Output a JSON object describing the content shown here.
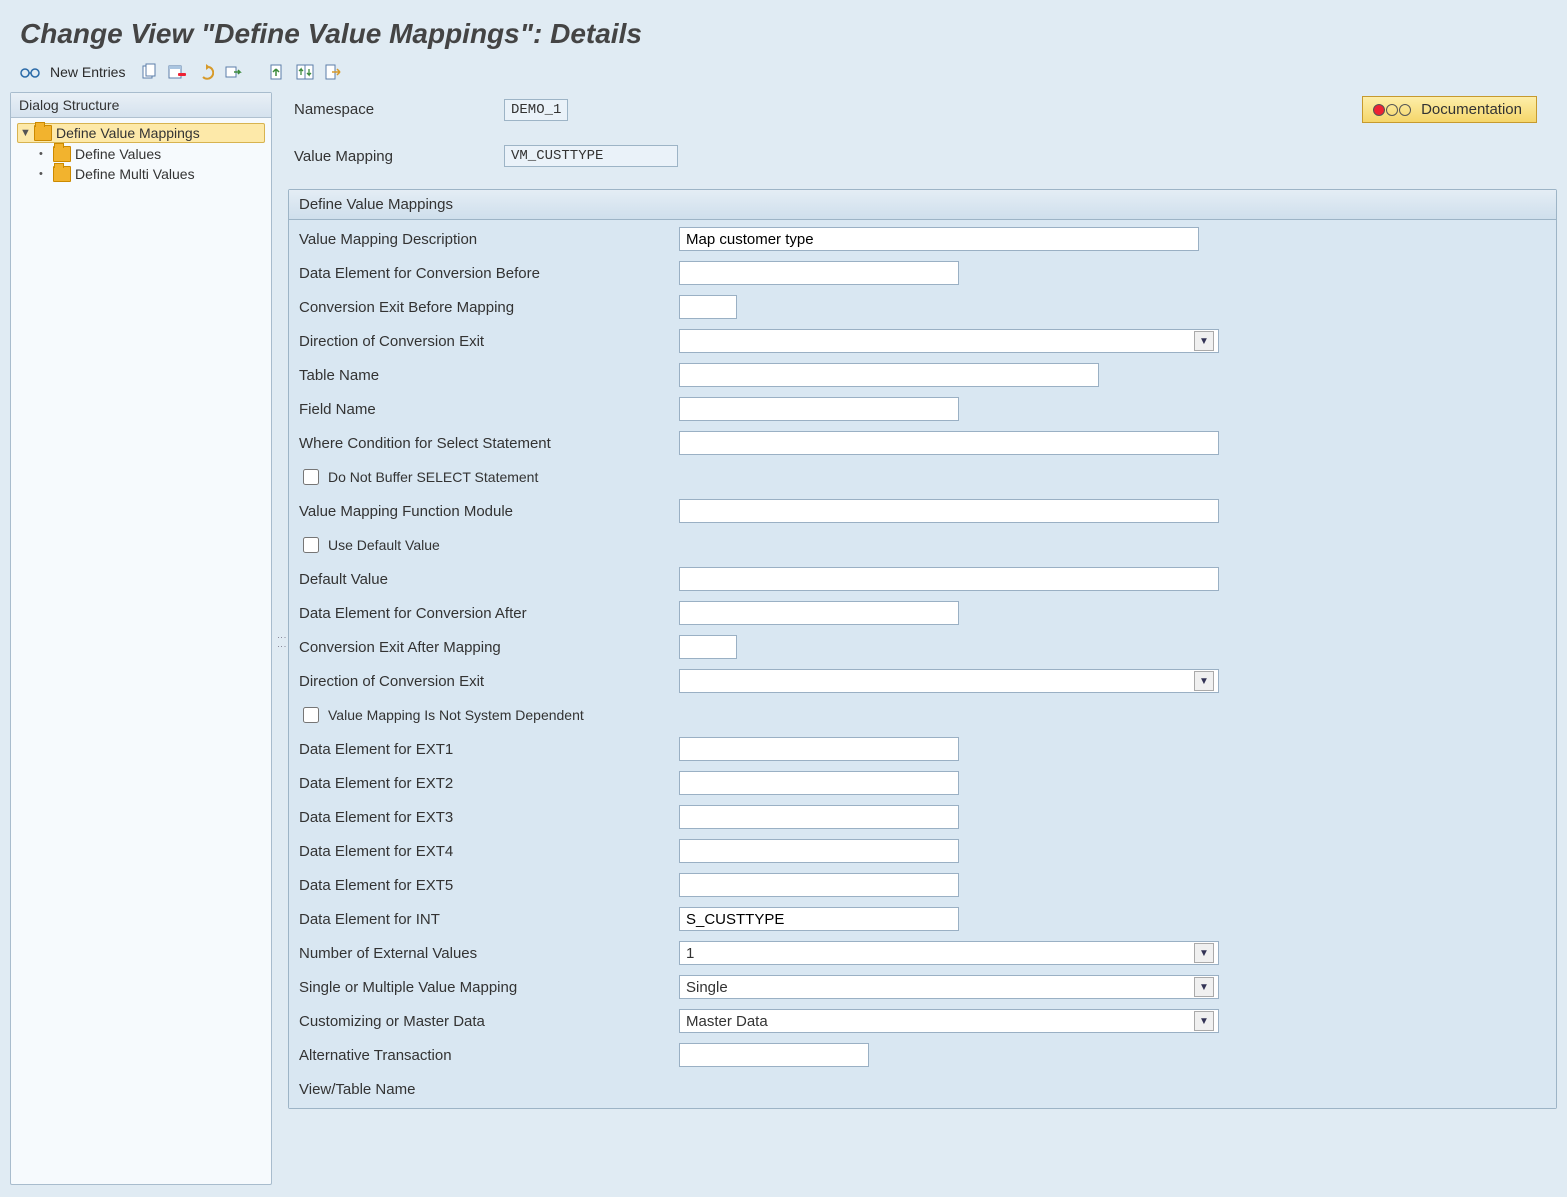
{
  "title": "Change View \"Define Value Mappings\": Details",
  "toolbar": {
    "new_entries": "New Entries"
  },
  "sidebar": {
    "header": "Dialog Structure",
    "items": [
      {
        "label": "Define Value Mappings",
        "indent": 1,
        "open": true,
        "selected": true
      },
      {
        "label": "Define Values",
        "indent": 2,
        "open": false,
        "selected": false
      },
      {
        "label": "Define Multi Values",
        "indent": 2,
        "open": false,
        "selected": false
      }
    ]
  },
  "header_fields": {
    "namespace_label": "Namespace",
    "namespace_value": "DEMO_1",
    "value_mapping_label": "Value Mapping",
    "value_mapping_value": "VM_CUSTTYPE",
    "documentation_button": "Documentation"
  },
  "panel": {
    "title": "Define Value Mappings",
    "fields": {
      "desc_label": "Value Mapping Description",
      "desc_value": "Map customer type",
      "de_before_label": "Data Element for Conversion Before",
      "de_before_value": "",
      "ce_before_label": "Conversion Exit Before Mapping",
      "ce_before_value": "",
      "dir_before_label": "Direction of Conversion Exit",
      "dir_before_value": "",
      "table_label": "Table Name",
      "table_value": "",
      "field_label": "Field Name",
      "field_value": "",
      "where_label": "Where Condition for Select Statement",
      "where_value": "",
      "no_buffer_label": "Do Not Buffer SELECT Statement",
      "func_mod_label": "Value Mapping Function Module",
      "func_mod_value": "",
      "use_default_label": "Use Default Value",
      "default_label": "Default Value",
      "default_value": "",
      "de_after_label": "Data Element for Conversion After",
      "de_after_value": "",
      "ce_after_label": "Conversion Exit After Mapping",
      "ce_after_value": "",
      "dir_after_label": "Direction of Conversion Exit",
      "dir_after_value": "",
      "not_sysdep_label": "Value Mapping Is Not System Dependent",
      "ext1_label": "Data Element for EXT1",
      "ext1_value": "",
      "ext2_label": "Data Element for EXT2",
      "ext2_value": "",
      "ext3_label": "Data Element for EXT3",
      "ext3_value": "",
      "ext4_label": "Data Element for EXT4",
      "ext4_value": "",
      "ext5_label": "Data Element for EXT5",
      "ext5_value": "",
      "int_label": "Data Element for INT",
      "int_value": "S_CUSTTYPE",
      "num_ext_label": "Number of External Values",
      "num_ext_value": "1",
      "single_multi_label": "Single or Multiple Value Mapping",
      "single_multi_value": "Single",
      "cust_master_label": "Customizing or Master Data",
      "cust_master_value": "Master Data",
      "alt_tx_label": "Alternative Transaction",
      "alt_tx_value": "",
      "view_table_label": "View/Table Name"
    }
  }
}
